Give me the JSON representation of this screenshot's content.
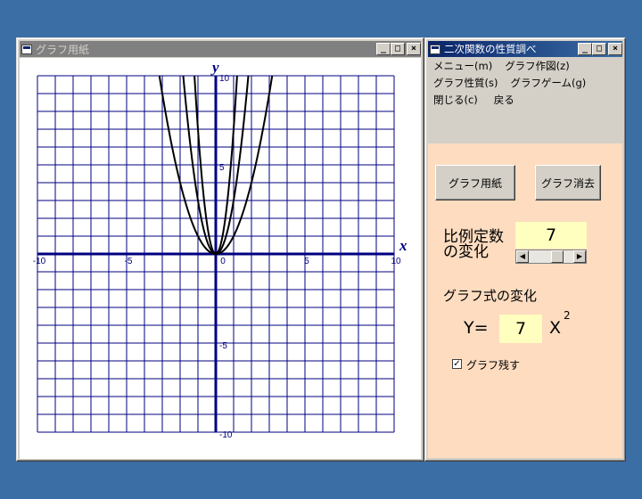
{
  "graph_window": {
    "title": "グラフ用紙",
    "axis": {
      "x_label": "x",
      "y_label": "y",
      "x_ticks": [
        "-10",
        "-5",
        "0",
        "5",
        "10"
      ],
      "y_ticks": [
        "10",
        "5",
        "-5",
        "-10"
      ],
      "x_range": [
        -10,
        10
      ],
      "y_range": [
        -10,
        10
      ],
      "grid_step": 1
    },
    "curves": [
      {
        "coef": 1,
        "color": "#000000"
      },
      {
        "coef": 3,
        "color": "#000000"
      },
      {
        "coef": 7,
        "color": "#000000"
      }
    ],
    "grid_color": "#000080",
    "axis_color": "#000080"
  },
  "control_window": {
    "title": "二次関数の性質調べ",
    "menu": {
      "row1": [
        "メニュー(m)",
        "グラフ作図(z)"
      ],
      "row2": [
        "グラフ性質(s)",
        "グラフゲーム(g)"
      ],
      "row3": [
        "閉じる(c)",
        "戻る"
      ]
    },
    "buttons": {
      "graph_paper": "グラフ用紙",
      "graph_clear": "グラフ消去"
    },
    "coef_label_1": "比例定数",
    "coef_label_2": "の変化",
    "coef_value": "7",
    "slider_level": 0.7,
    "formula_heading": "グラフ式の変化",
    "formula_prefix": "Y=",
    "formula_value": "7",
    "formula_var": "X",
    "formula_exp": "2",
    "keep_graph_label": "グラフ残す",
    "keep_graph_checked": "✓"
  },
  "colors": {
    "desktop": "#3a6ea5",
    "panel": "#fddcc0",
    "value_box": "#ffffc0"
  }
}
